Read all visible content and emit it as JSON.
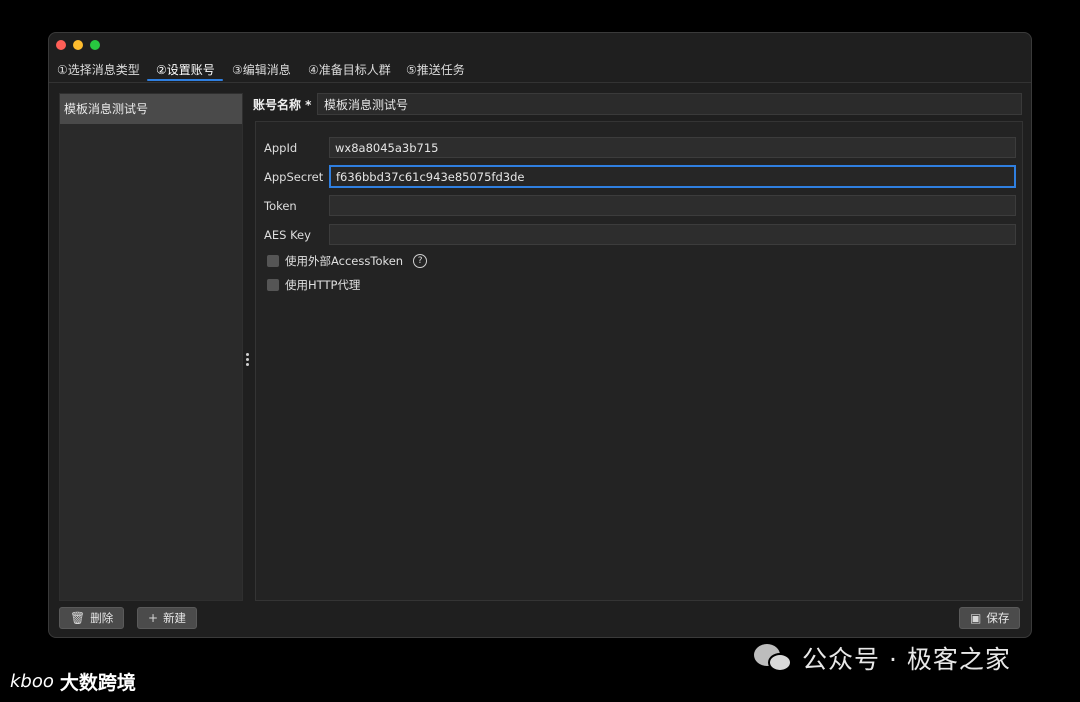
{
  "tabs": [
    {
      "label": "①选择消息类型"
    },
    {
      "label": "②设置账号"
    },
    {
      "label": "③编辑消息"
    },
    {
      "label": "④准备目标人群"
    },
    {
      "label": "⑤推送任务"
    }
  ],
  "sidebar": {
    "items": [
      {
        "label": "模板消息测试号"
      }
    ]
  },
  "account": {
    "name_label": "账号名称 *",
    "name_value": "模板消息测试号"
  },
  "fields": {
    "appid": {
      "label": "AppId",
      "value": "wx8a8045a3b715"
    },
    "appsecret": {
      "label": "AppSecret",
      "value": "f636bbd37c61c943e85075fd3de"
    },
    "token": {
      "label": "Token",
      "value": ""
    },
    "aeskey": {
      "label": "AES Key",
      "value": ""
    }
  },
  "options": {
    "external_token": {
      "label": "使用外部AccessToken",
      "checked": false
    },
    "http_proxy": {
      "label": "使用HTTP代理",
      "checked": false
    }
  },
  "buttons": {
    "delete": "删除",
    "new": "新建",
    "save": "保存"
  },
  "watermark": {
    "left_logo": "kboo",
    "left_text": "大数跨境",
    "right_text": "公众号 · 极客之家"
  },
  "colors": {
    "accent": "#2f7fe0",
    "window_bg": "#1f1f1f",
    "traffic_red": "#ff5f57",
    "traffic_yellow": "#febc2e",
    "traffic_green": "#28c840"
  }
}
